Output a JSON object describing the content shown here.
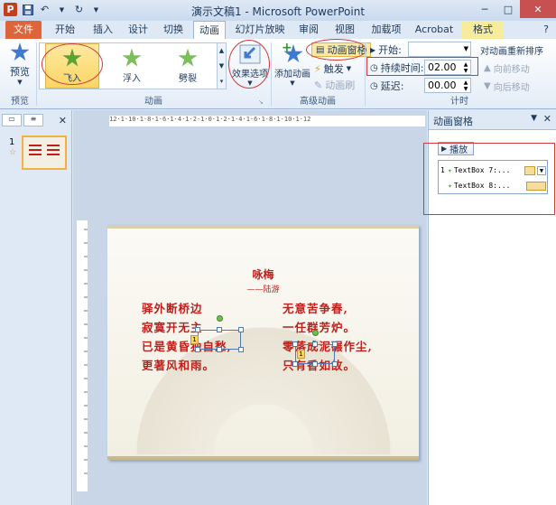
{
  "window": {
    "title": "演示文稿1 - Microsoft PowerPoint"
  },
  "tabs": [
    {
      "label": "文件"
    },
    {
      "label": "开始"
    },
    {
      "label": "插入"
    },
    {
      "label": "设计"
    },
    {
      "label": "切换"
    },
    {
      "label": "动画"
    },
    {
      "label": "幻灯片放映"
    },
    {
      "label": "审阅"
    },
    {
      "label": "视图"
    },
    {
      "label": "加载项"
    },
    {
      "label": "Acrobat"
    },
    {
      "label": "格式"
    }
  ],
  "ribbon": {
    "preview": {
      "label": "预览",
      "group_label": "预览"
    },
    "animations": {
      "items": [
        {
          "label": "飞入",
          "selected": true,
          "color": "#5aa332"
        },
        {
          "label": "浮入",
          "selected": false,
          "color": "#7cbf5a"
        },
        {
          "label": "劈裂",
          "selected": false,
          "color": "#7cbf5a"
        }
      ],
      "effect_options": "效果选项",
      "group_label": "动画"
    },
    "advanced": {
      "add_animation": "添加动画",
      "animation_pane": "动画窗格",
      "trigger": "触发",
      "animation_painter": "动画刷",
      "group_label": "高级动画"
    },
    "timing": {
      "start_label": "开始:",
      "start_value": "",
      "duration_label": "持续时间:",
      "duration_value": "02.00",
      "delay_label": "延迟:",
      "delay_value": "00.00",
      "reorder_label": "对动画重新排序",
      "move_earlier": "向前移动",
      "move_later": "向后移动",
      "group_label": "计时"
    }
  },
  "slides_panel": {
    "slide_number": "1"
  },
  "slide": {
    "title": "咏梅",
    "author": "——陆游",
    "left_lines": [
      "驿外断桥边",
      "寂寞开无主",
      "已是黄昏独自愁,",
      "更著风和雨。"
    ],
    "right_lines": [
      "无意苦争春,",
      "一任群芳炉。",
      "零落成泥碾作尘,",
      "只有香如故。"
    ],
    "anim_tags": [
      "1",
      "1"
    ]
  },
  "ruler": {
    "h_ticks": "12·1·10·1·8·1·6·1·4·1·2·1·0·1·2·1·4·1·6·1·8·1·10·1·12"
  },
  "animation_pane": {
    "title": "动画窗格",
    "play_label": "播放",
    "items": [
      {
        "index": "1",
        "name": "TextBox 7:..."
      },
      {
        "index": "",
        "name": "TextBox 8:..."
      }
    ]
  }
}
